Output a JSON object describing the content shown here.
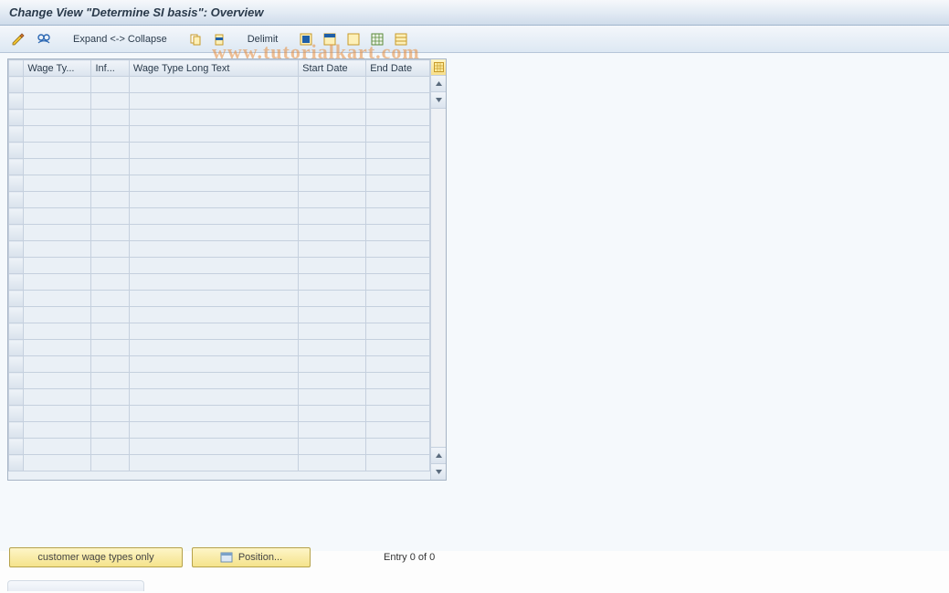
{
  "title": "Change View \"Determine SI basis\": Overview",
  "toolbar": {
    "expand_collapse": "Expand <-> Collapse",
    "delimit": "Delimit"
  },
  "icons": {
    "glasses": "display-change-icon",
    "wand": "selection-criteria-icon",
    "copy": "copy-icon",
    "delete": "delete-icon",
    "select_all": "select-all-icon",
    "select_block": "select-block-icon",
    "deselect": "deselect-all-icon",
    "table_settings": "table-settings-icon",
    "print": "print-icon"
  },
  "table": {
    "columns": {
      "wage_type": "Wage Ty...",
      "inf": "Inf...",
      "wage_type_long": "Wage Type Long Text",
      "start_date": "Start Date",
      "end_date": "End Date"
    },
    "row_count": 24,
    "rows": []
  },
  "footer": {
    "customer_btn": "customer wage types only",
    "position_btn": "Position...",
    "entry_text": "Entry 0 of 0"
  },
  "watermark": "www.tutorialkart.com"
}
